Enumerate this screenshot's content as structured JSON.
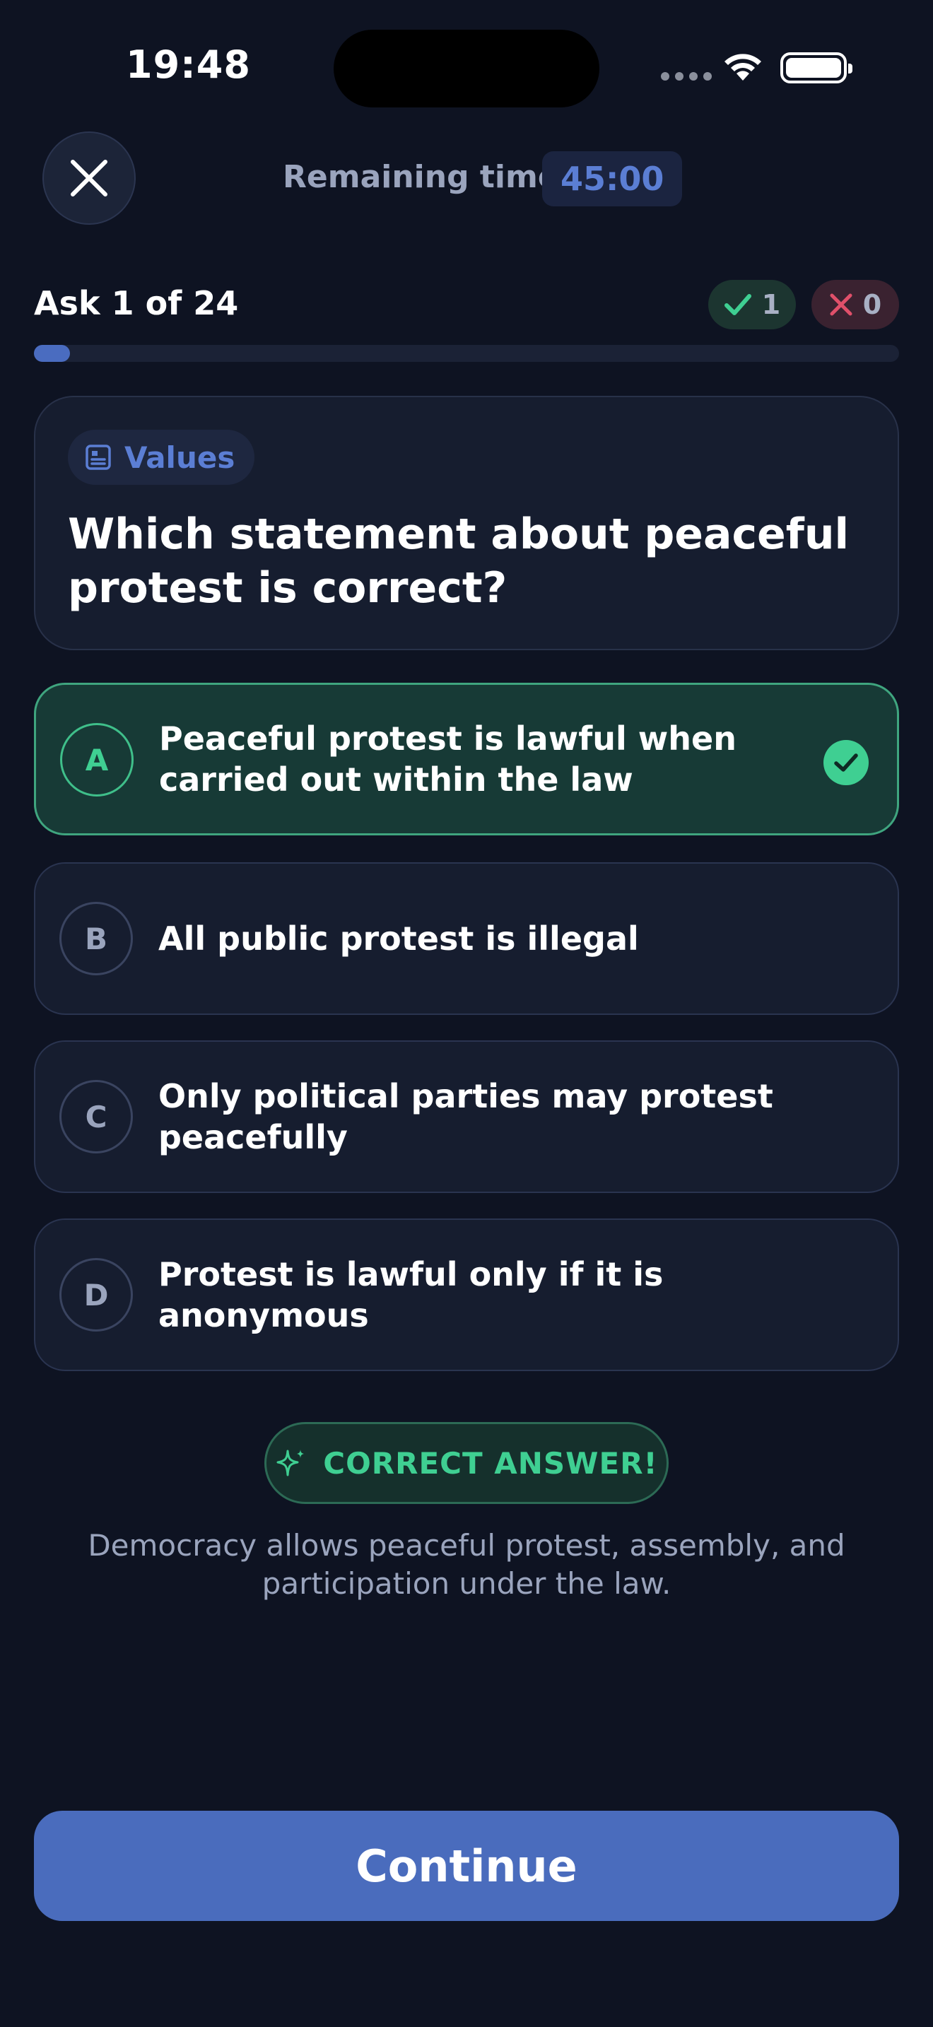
{
  "status_bar": {
    "time": "19:48"
  },
  "header": {
    "remaining_label": "Remaining time",
    "timer": "45:00"
  },
  "progress": {
    "ask_label": "Ask 1 of 24",
    "correct_count": "1",
    "wrong_count": "0",
    "fraction": 0.0417
  },
  "question": {
    "category": "Values",
    "text": "Which statement about peaceful protest is correct?"
  },
  "options": [
    {
      "letter": "A",
      "text": "Peaceful protest is lawful when carried out within the law",
      "selected": true
    },
    {
      "letter": "B",
      "text": "All public protest is illegal",
      "selected": false
    },
    {
      "letter": "C",
      "text": "Only political parties may protest peacefully",
      "selected": false
    },
    {
      "letter": "D",
      "text": "Protest is lawful only if it is anonymous",
      "selected": false
    }
  ],
  "feedback": {
    "badge": "CORRECT ANSWER!",
    "explanation": "Democracy allows peaceful protest, assembly, and participation under the law."
  },
  "continue_label": "Continue",
  "colors": {
    "background": "#0e1322",
    "accent": "#4a6cbd",
    "correct": "#3fcf92",
    "wrong": "#e0506a"
  }
}
